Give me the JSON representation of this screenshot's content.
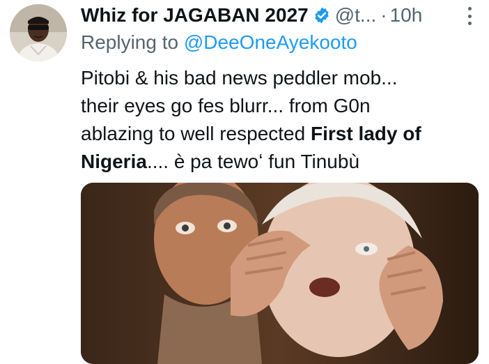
{
  "author": {
    "display_name": "Whiz for JAGABAN 2027",
    "handle": "@t...",
    "separator": "·",
    "time": "10h",
    "verified_icon": "verified-badge-icon",
    "badge_color": "#1d9bf0"
  },
  "reply": {
    "prefix": "Replying to",
    "mention": "@DeeOneAyekooto"
  },
  "tweet": {
    "lines": [
      "Pitobi & his bad news peddler mob...",
      "their eyes go fes blurr... from G0n",
      "ablazing to well respected "
    ],
    "bold_1": "First lady of",
    "bold_2": "Nigeria",
    "tail": ".... è pa tewoʻ fun Tinubù"
  },
  "colors": {
    "link": "#1d9bf0",
    "secondary_text": "#536471",
    "primary_text": "#0f1419"
  }
}
